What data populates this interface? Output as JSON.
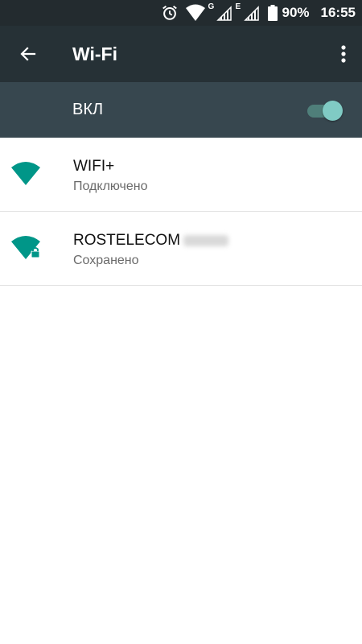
{
  "status_bar": {
    "alarm_icon": "alarm-icon",
    "wifi_icon": "wifi-signal-icon",
    "network_type_1": "G",
    "network_type_2": "E",
    "signal_icon": "cell-signal-icon",
    "battery_icon": "battery-icon",
    "battery_percent": "90%",
    "time": "16:55"
  },
  "app_bar": {
    "title": "Wi-Fi",
    "back_icon": "arrow-back-icon",
    "more_icon": "more-vert-icon"
  },
  "master_switch": {
    "label": "ВКЛ",
    "state": "on"
  },
  "networks": [
    {
      "name": "WIFI+",
      "status": "Подключено",
      "secured": false,
      "signal_icon": "wifi-signal-icon"
    },
    {
      "name": "ROSTELECOM",
      "status": "Сохранено",
      "secured": true,
      "signal_icon": "wifi-lock-icon"
    }
  ],
  "colors": {
    "status_bar": "#232b2f",
    "app_bar": "#263136",
    "switch_bar": "#37474f",
    "accent": "#009688",
    "toggle_thumb": "#80cbc4"
  }
}
